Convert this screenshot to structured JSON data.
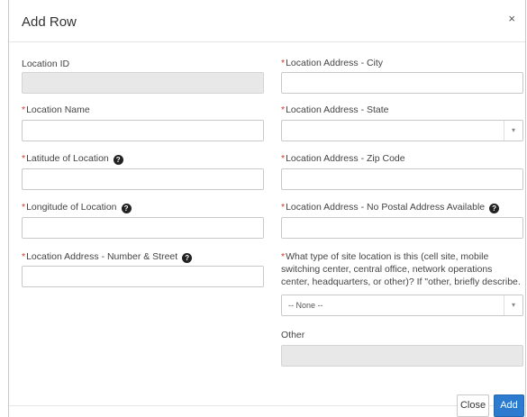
{
  "dialog": {
    "title": "Add Row",
    "close_glyph": "×"
  },
  "required_marker": "*",
  "help_glyph": "?",
  "fields": {
    "location_id": {
      "label": "Location ID",
      "value": ""
    },
    "location_name": {
      "label": "Location Name",
      "value": ""
    },
    "latitude": {
      "label": "Latitude of Location",
      "value": ""
    },
    "longitude": {
      "label": "Longitude of Location",
      "value": ""
    },
    "street": {
      "label": "Location Address - Number & Street",
      "value": ""
    },
    "city": {
      "label": "Location Address - City",
      "value": ""
    },
    "state": {
      "label": "Location Address - State",
      "value": ""
    },
    "zip": {
      "label": "Location Address - Zip Code",
      "value": ""
    },
    "no_postal": {
      "label": "Location Address - No Postal Address Available",
      "value": ""
    },
    "site_type": {
      "label": "What type of site location is this (cell site, mobile switching center, central office, network operations center, headquarters, or other)? If \"other, briefly describe.",
      "selected": "-- None --"
    },
    "other": {
      "label": "Other",
      "value": ""
    }
  },
  "buttons": {
    "close": "Close",
    "add": "Add"
  },
  "colors": {
    "required": "#d9342b",
    "primary_button": "#2d7bcf",
    "disabled_input": "#e8e8e8"
  }
}
